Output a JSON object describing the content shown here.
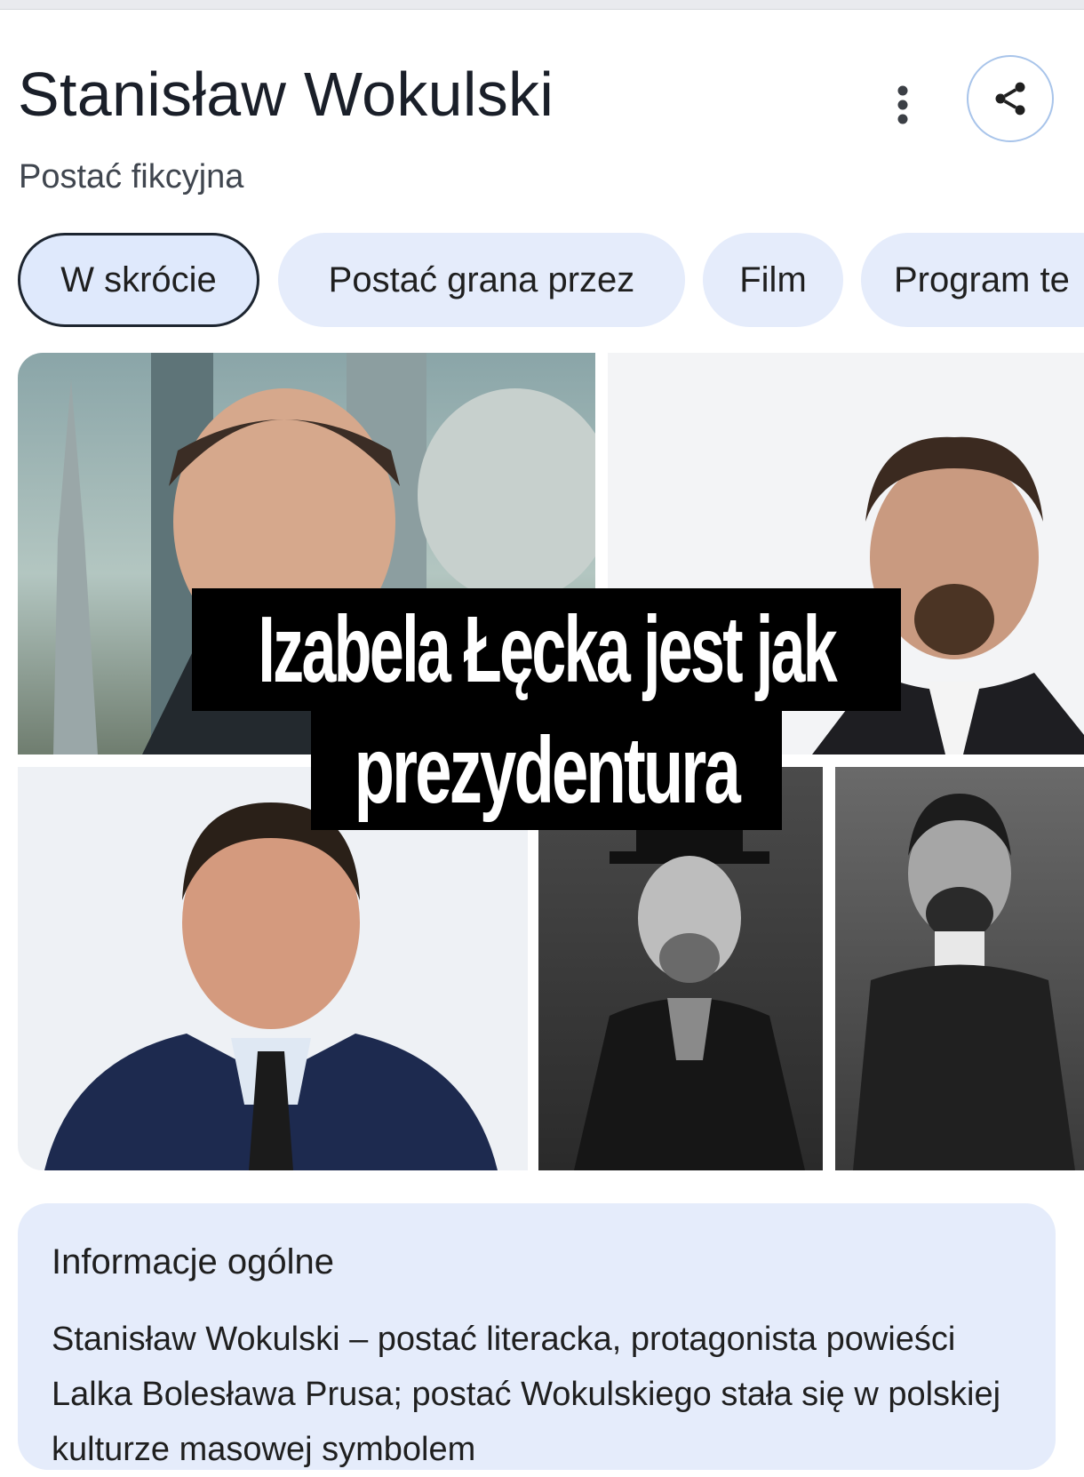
{
  "header": {
    "title": "Stanisław Wokulski",
    "subtitle": "Postać fikcyjna",
    "more_icon": "more-vertical-icon",
    "share_icon": "share-icon"
  },
  "chips": [
    {
      "label": "W skrócie",
      "active": true
    },
    {
      "label": "Postać grana przez",
      "active": false
    },
    {
      "label": "Film",
      "active": false
    },
    {
      "label": "Program te",
      "active": false
    }
  ],
  "overlay": {
    "line1": "Izabela Łęcka jest jak",
    "line2": "prezydentura"
  },
  "info": {
    "title": "Informacje ogólne",
    "text": "Stanisław Wokulski – postać literacka, protagonista powieści Lalka Bolesława Prusa; postać Wokulskiego stała się w polskiej kulturze masowej symbolem"
  },
  "colors": {
    "chip_bg": "#e5ecfb",
    "share_border": "#a8c4ea",
    "title_text": "#1a1f29"
  }
}
